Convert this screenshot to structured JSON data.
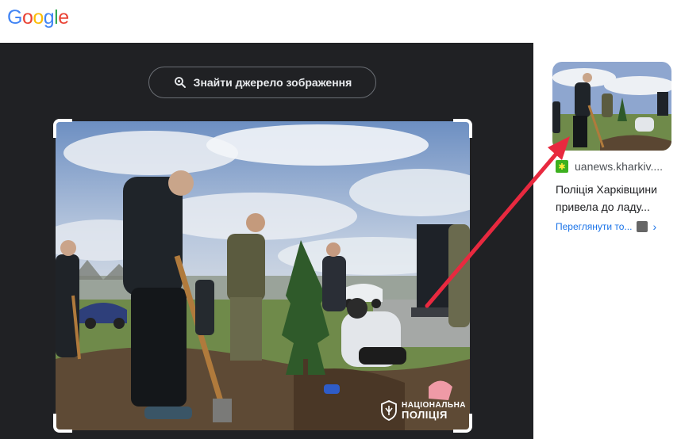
{
  "header": {
    "logo_letters": [
      {
        "ch": "G",
        "color": "#4285F4"
      },
      {
        "ch": "o",
        "color": "#EA4335"
      },
      {
        "ch": "o",
        "color": "#FBBC05"
      },
      {
        "ch": "g",
        "color": "#4285F4"
      },
      {
        "ch": "l",
        "color": "#34A853"
      },
      {
        "ch": "e",
        "color": "#EA4335"
      }
    ]
  },
  "viewer": {
    "find_source_label": "Знайти джерело зображення",
    "watermark_line1": "НАЦІОНАЛЬНА",
    "watermark_line2": "ПОЛІЦІЯ"
  },
  "result": {
    "source_name": "uanews.kharkiv....",
    "title": "Поліція Харківщини привела до ладу...",
    "visit_label": "Переглянути то...",
    "chevron": "›"
  },
  "colors": {
    "viewer_bg": "#202124",
    "accent_link": "#1a73e8",
    "arrow": "#e8293f"
  }
}
